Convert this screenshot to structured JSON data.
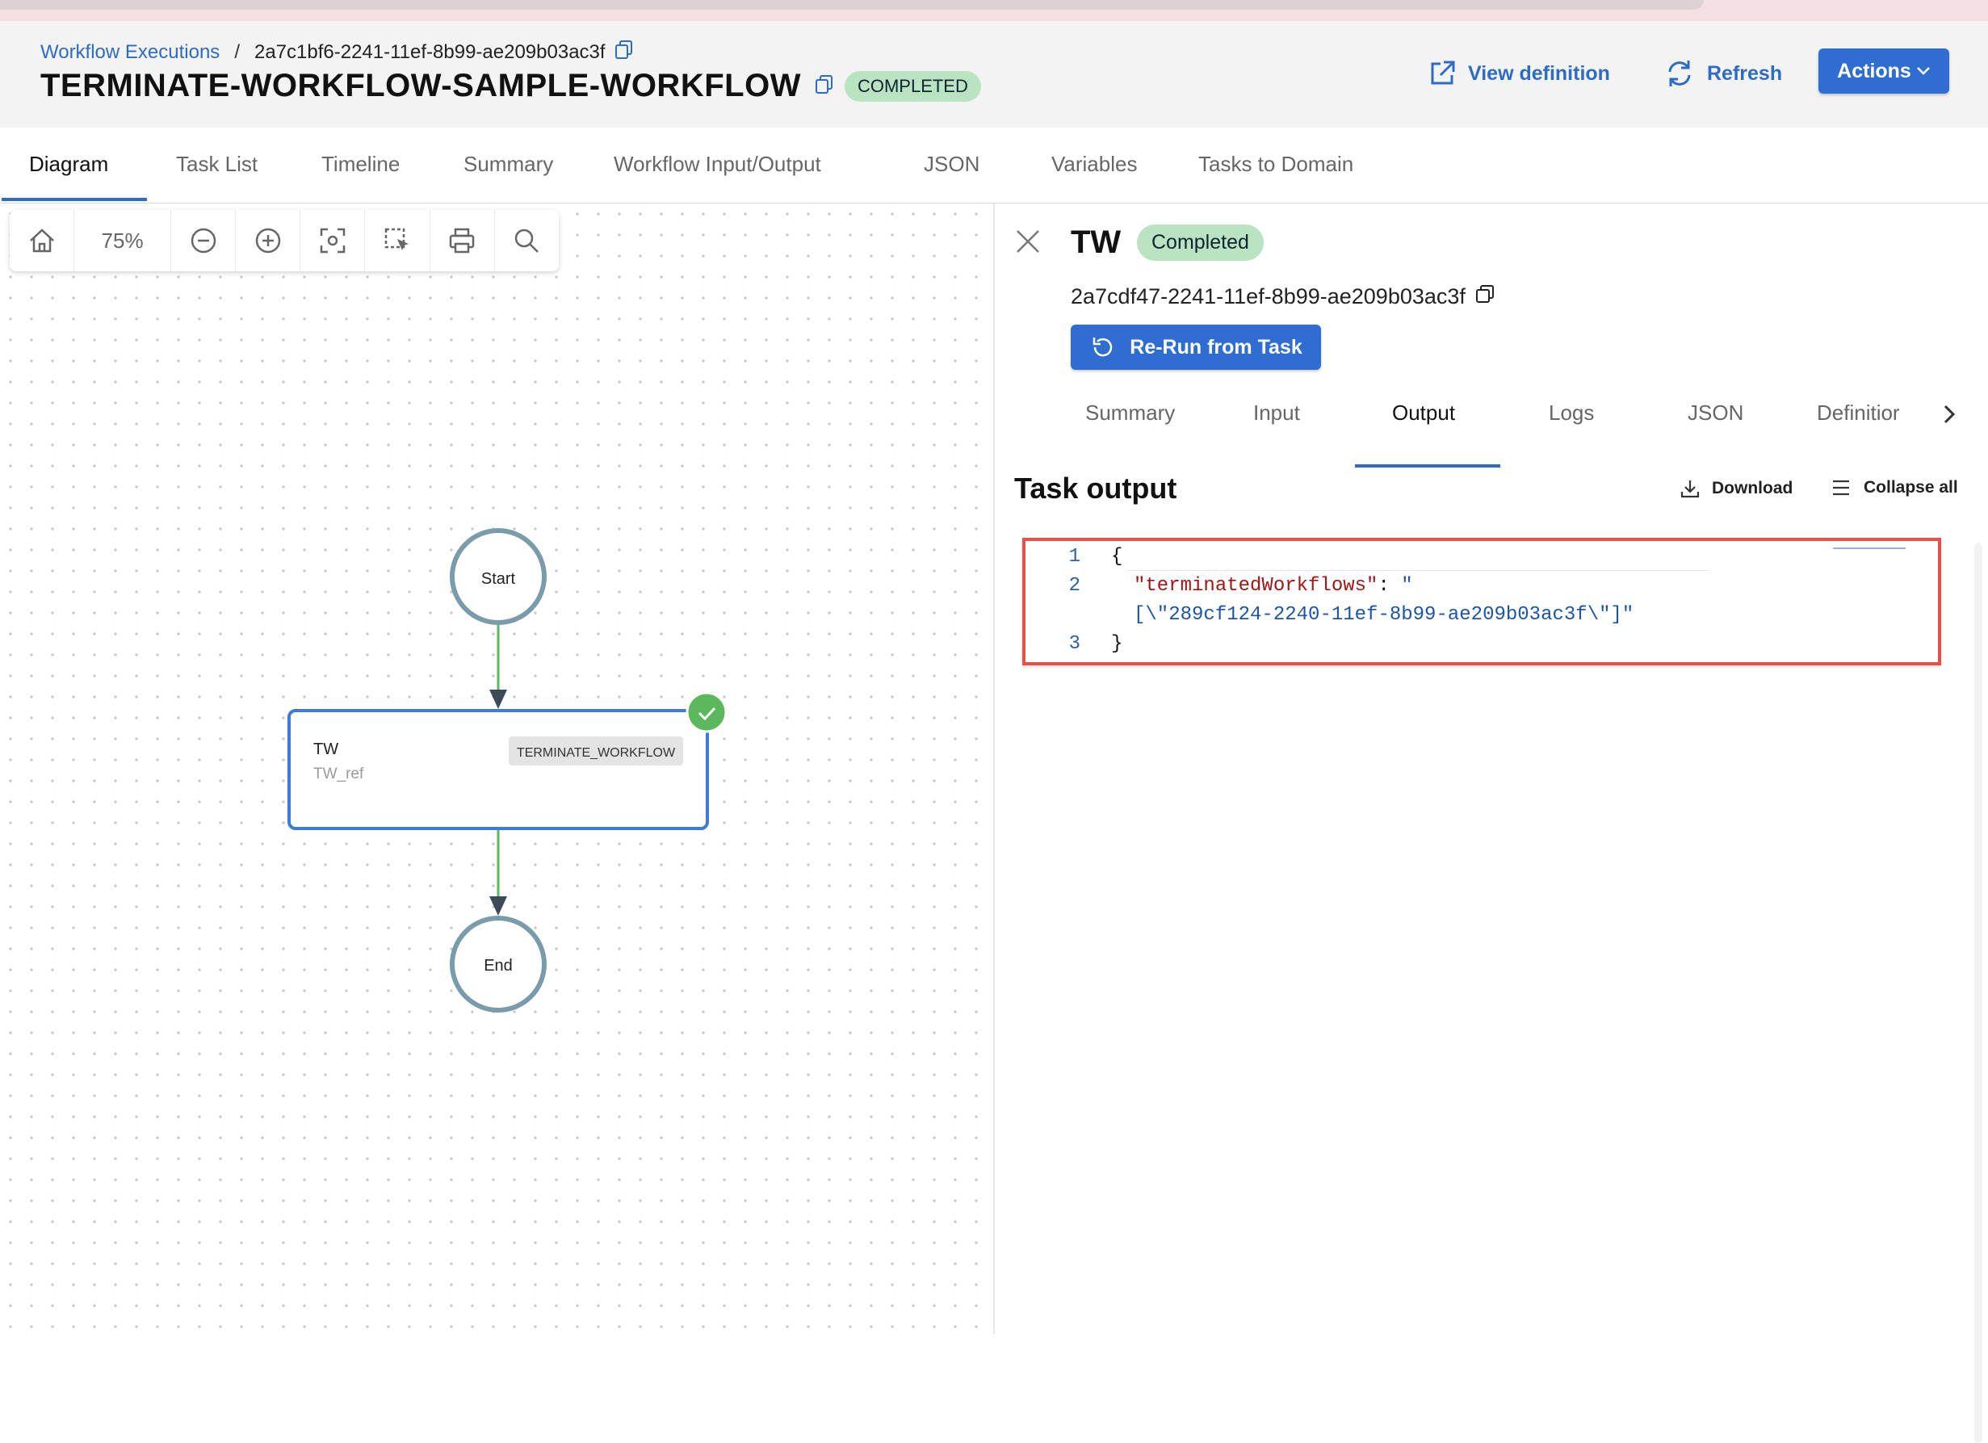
{
  "breadcrumb": {
    "link": "Workflow Executions",
    "separator": "/",
    "execution_id": "2a7c1bf6-2241-11ef-8b99-ae209b03ac3f"
  },
  "workflow": {
    "name": "TERMINATE-WORKFLOW-SAMPLE-WORKFLOW",
    "status": "COMPLETED"
  },
  "header_buttons": {
    "view_definition": "View definition",
    "refresh": "Refresh",
    "actions": "Actions"
  },
  "tabs": [
    "Diagram",
    "Task List",
    "Timeline",
    "Summary",
    "Workflow Input/Output",
    "JSON",
    "Variables",
    "Tasks to Domain"
  ],
  "toolbar": {
    "zoom": "75%"
  },
  "diagram": {
    "start_label": "Start",
    "end_label": "End",
    "task": {
      "name": "TW",
      "ref": "TW_ref",
      "type": "TERMINATE_WORKFLOW"
    }
  },
  "task_panel": {
    "title": "TW",
    "status": "Completed",
    "task_id": "2a7cdf47-2241-11ef-8b99-ae209b03ac3f",
    "rerun_label": "Re-Run from Task",
    "subtabs": [
      "Summary",
      "Input",
      "Output",
      "Logs",
      "JSON",
      "Definitior"
    ],
    "output_title": "Task output",
    "download_label": "Download",
    "collapse_label": "Collapse all",
    "code": {
      "line_numbers": [
        "1",
        "2",
        "3"
      ],
      "open_brace": "{",
      "key": "\"terminatedWorkflows\"",
      "colon": ": ",
      "value_start": "\"",
      "value_cont": "[\\\"289cf124-2240-11ef-8b99-ae209b03ac3f\\\"]\"",
      "close_brace": "}"
    }
  },
  "colors": {
    "accent": "#2f6ed0",
    "link": "#2d6bc4",
    "success": "#b9e3c1",
    "edge": "#5cb85c",
    "highlight": "#e0524b"
  }
}
